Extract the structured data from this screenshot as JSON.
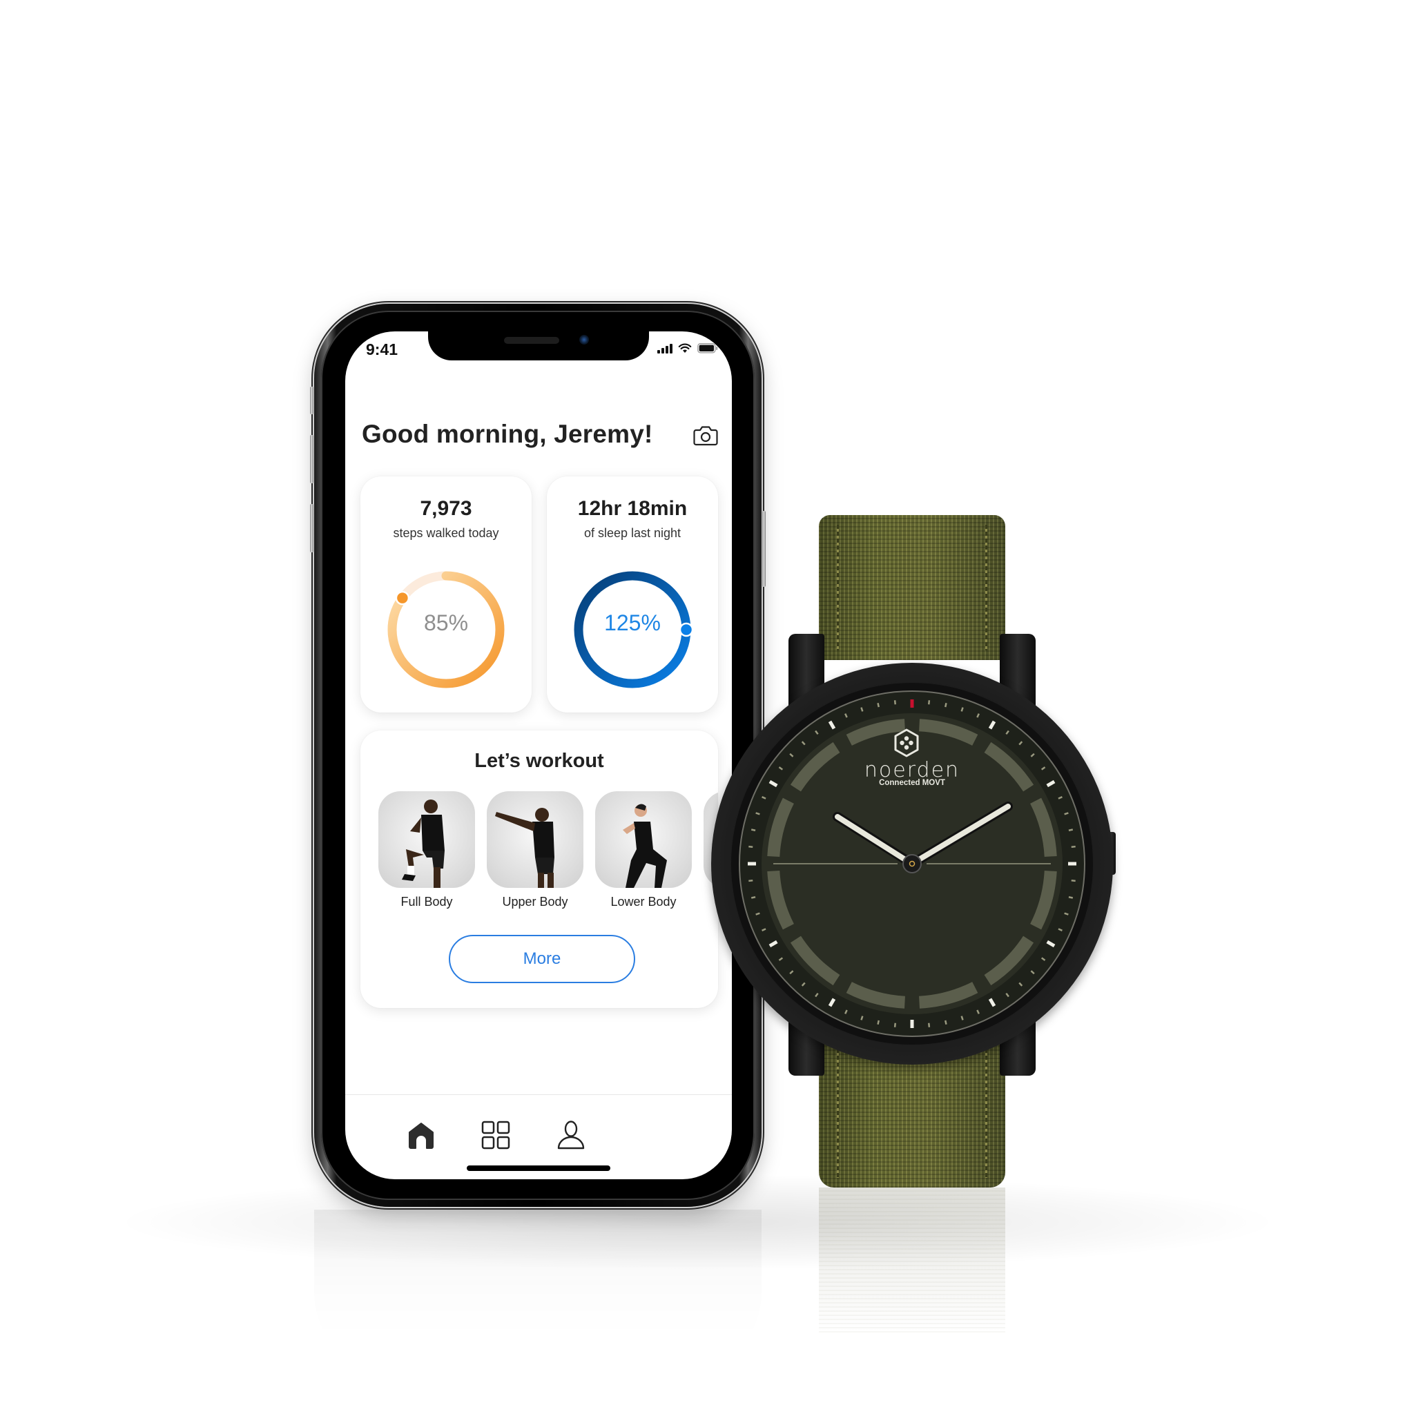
{
  "phone": {
    "status_bar": {
      "time": "9:41",
      "icons": [
        "cellular-signal-icon",
        "wifi-icon",
        "battery-icon"
      ]
    },
    "header": {
      "greeting": "Good morning, Jeremy!",
      "camera_icon": "camera-icon"
    },
    "stats": [
      {
        "id": "steps",
        "value": "7,973",
        "label": "steps walked today",
        "percent_text": "85%",
        "progress_percent": 85,
        "color_start": "#F5962A",
        "color_end": "#FDE0B0",
        "track_color": "#FCEBDC",
        "text_color": "#8E8E8E"
      },
      {
        "id": "sleep",
        "value": "12hr 18min",
        "label": "of sleep last night",
        "percent_text": "125%",
        "progress_percent": 125,
        "color_start": "#0A80E8",
        "color_end": "#063D75",
        "text_color": "#1E86E5"
      }
    ],
    "workout": {
      "title": "Let’s workout",
      "items": [
        {
          "label": "Full Body"
        },
        {
          "label": "Upper Body"
        },
        {
          "label": "Lower Body"
        },
        {
          "label": ""
        }
      ],
      "more_label": "More",
      "accent": "#2A7DE1"
    },
    "tab_bar": {
      "tabs": [
        {
          "name": "home",
          "icon": "home-icon",
          "active": true
        },
        {
          "name": "grid",
          "icon": "grid-icon",
          "active": false
        },
        {
          "name": "profile",
          "icon": "user-icon",
          "active": false
        }
      ]
    }
  },
  "watch": {
    "brand": "noerden",
    "subtitle": "Connected MOVT",
    "dial_color": "#2B2E24",
    "strap_color": "#6B7034",
    "marker_color": "#C8102E"
  }
}
